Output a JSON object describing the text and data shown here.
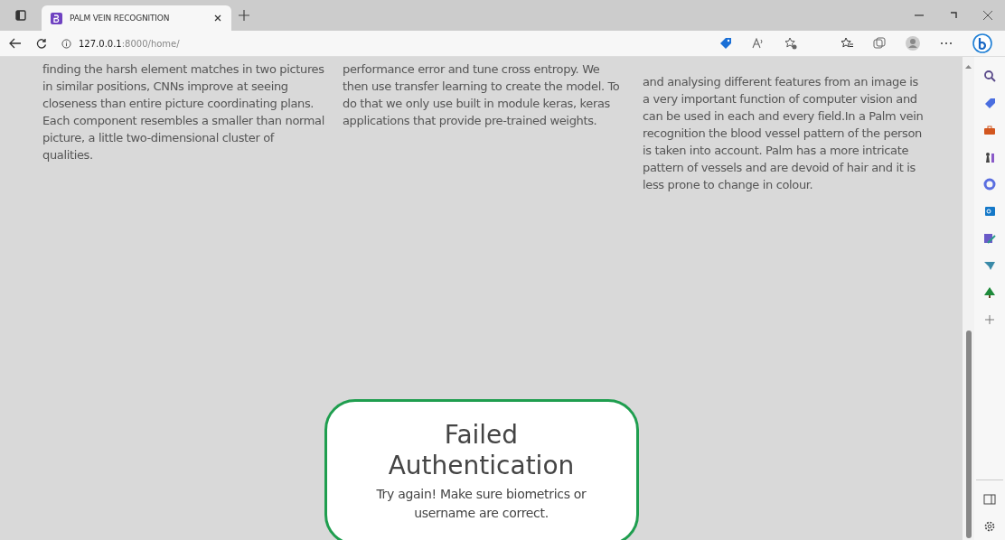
{
  "browser": {
    "tab_title": "PALM VEIN RECOGNITION",
    "url_host": "127.0.0.1",
    "url_path": ":8000/home/"
  },
  "columns": [
    {
      "text": "finding the harsh element matches in two pictures in similar positions, CNNs improve at seeing closeness than entire picture coordinating plans. Each component resembles a smaller than normal picture, a little two-dimensional cluster of qualities."
    },
    {
      "text": "performance error and tune cross entropy. We then use transfer learning to create the model. To do that we only use built in module keras, keras applications that provide pre-trained weights."
    },
    {
      "text": "and analysing different features from an image is a very important function of computer vision and can be used in each and every field.In a Palm vein recognition the blood vessel pattern of the person is taken into account. Palm has a more intricate pattern of vessels and are devoid of hair and it is less prone to change in colour."
    }
  ],
  "popup": {
    "title": "Failed Authentication",
    "message": "Try again! Make sure biometrics or username are correct."
  }
}
